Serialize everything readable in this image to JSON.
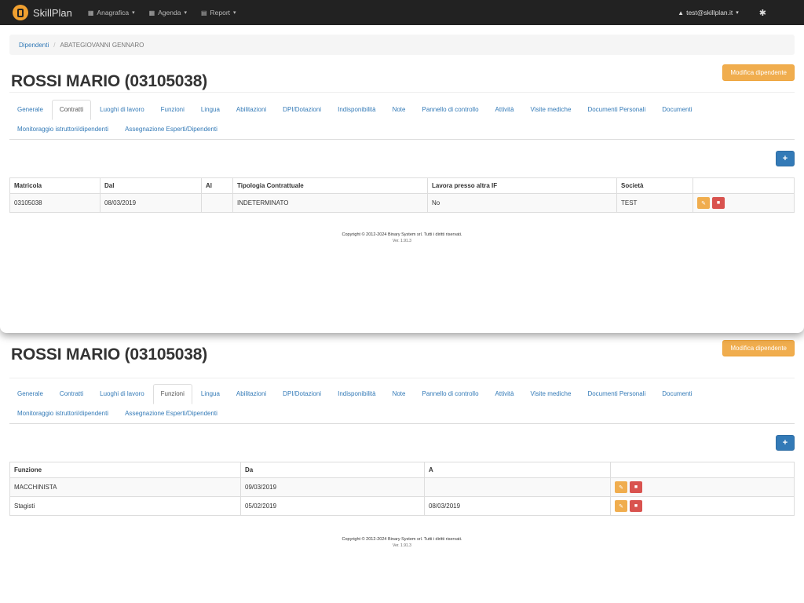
{
  "navbar": {
    "brand": "SkillPlan",
    "menus": [
      {
        "label": "Anagrafica",
        "icon": "calendar-icon"
      },
      {
        "label": "Agenda",
        "icon": "calendar-icon"
      },
      {
        "label": "Report",
        "icon": "document-icon"
      }
    ],
    "user": "test@skillplan.it"
  },
  "breadcrumb": {
    "link": "Dipendenti",
    "separator": "/",
    "current": "ABATEGIOVANNI GENNARO"
  },
  "page_title": "ROSSI MARIO (03105038)",
  "edit_button": "Modifica dipendente",
  "add_button": "+",
  "tabs": [
    "Generale",
    "Contratti",
    "Luoghi di lavoro",
    "Funzioni",
    "Lingua",
    "Abilitazioni",
    "DPI/Dotazioni",
    "Indisponibilità",
    "Note",
    "Pannello di controllo",
    "Attività",
    "Visite mediche",
    "Documenti Personali",
    "Documenti",
    "Monitoraggio istruttori/dipendenti",
    "Assegnazione Esperti/Dipendenti"
  ],
  "top_panel": {
    "active_tab": "Contratti",
    "table": {
      "headers": [
        "Matricola",
        "Dal",
        "Al",
        "Tipologia Contrattuale",
        "Lavora presso altra IF",
        "Società",
        ""
      ],
      "rows": [
        [
          "03105038",
          "08/03/2019",
          "",
          "INDETERMINATO",
          "No",
          "TEST"
        ]
      ]
    }
  },
  "bottom_panel": {
    "active_tab": "Funzioni",
    "table": {
      "headers": [
        "Funzione",
        "Da",
        "A",
        ""
      ],
      "rows": [
        [
          "MACCHINISTA",
          "09/03/2019",
          ""
        ],
        [
          "Stagisti",
          "05/02/2019",
          "08/03/2019"
        ]
      ]
    }
  },
  "footer": {
    "copyright": "Copyright © 2012-2024 Binary System srl. Tutti i diritti riservati.",
    "version": "Ver. 1.91.3"
  },
  "colors": {
    "navbar": "#222222",
    "primary": "#337ab7",
    "warning": "#f0ad4e",
    "danger": "#d9534f"
  }
}
